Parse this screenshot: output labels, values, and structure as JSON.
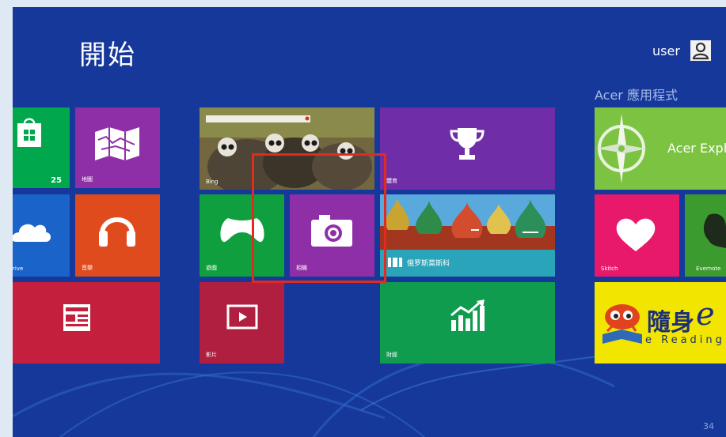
{
  "start_title": "開始",
  "user": {
    "name": "user"
  },
  "section_title": "Acer 應用程式",
  "tiles": {
    "store_badge": "25",
    "maps": "地圖",
    "skydrive": "rive",
    "music": "音樂",
    "bing": "Bing",
    "games": "遊戲",
    "camera": "相機",
    "video": "影片",
    "sports": "體育",
    "travel_caption": "俄罗斯莫斯科",
    "finance": "財經",
    "acer_explorer": "Acer Expl",
    "skitch": "Skitch",
    "evernote": "Evernote",
    "ereading_cn": "隨身",
    "ereading_e": "e",
    "ereading_en": "e Reading"
  },
  "colors": {
    "background": "#16389b",
    "highlight": "#e02b22"
  },
  "page_number": "34"
}
